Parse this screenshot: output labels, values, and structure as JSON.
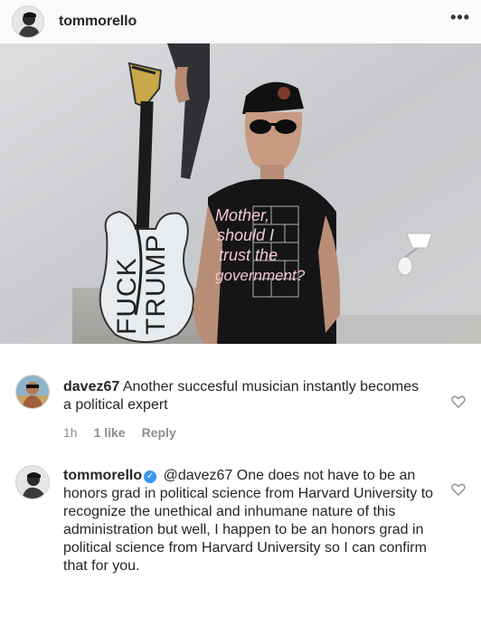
{
  "post": {
    "username": "tommorello",
    "more_icon": "more-horizontal-icon",
    "more_glyph": "•••"
  },
  "photo": {
    "guitar_text_1": "FUCK",
    "guitar_text_2": "TRUMP",
    "shirt_lines": [
      "Mother,",
      "should I",
      "trust the",
      "government?"
    ]
  },
  "comments": [
    {
      "username": "davez67",
      "text": "Another succesful musician instantly becomes a political expert",
      "time": "1h",
      "likes": "1 like",
      "reply_label": "Reply",
      "verified": false
    },
    {
      "username": "tommorello",
      "verified": true,
      "mention": "@davez67",
      "text": "One does not have to be an honors grad in political science from Harvard University to recognize the unethical and inhumane nature of this administration but well, I happen to be an honors grad in political science from Harvard University so I can confirm that for you."
    }
  ],
  "colors": {
    "verified_badge": "#3897f0",
    "meta_text": "#8e8e8e",
    "text": "#262626"
  }
}
